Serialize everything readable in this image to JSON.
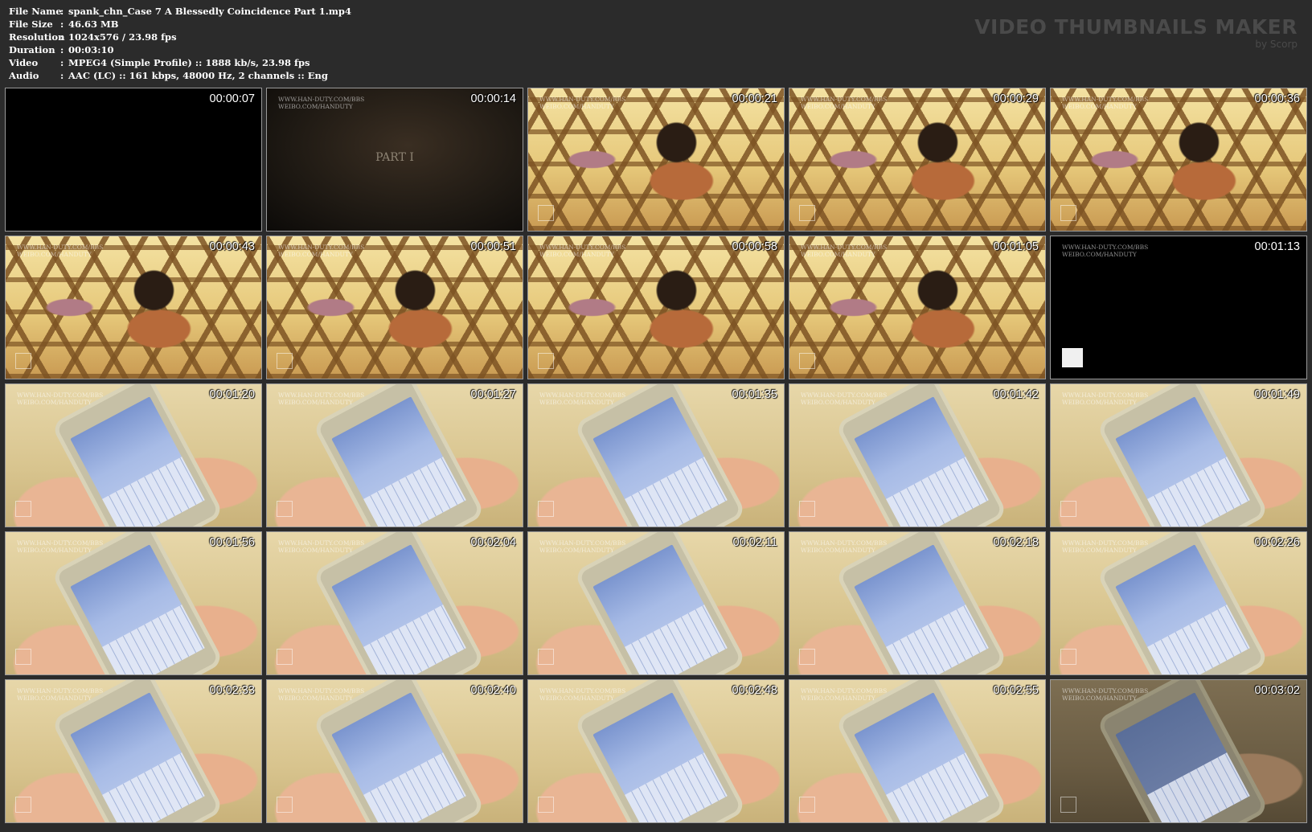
{
  "info": {
    "rows": [
      {
        "key": "File Name",
        "sep": ":",
        "value": "spank_chn_Case 7 A Blessedly Coincidence Part 1.mp4"
      },
      {
        "key": "File Size",
        "sep": ":",
        "value": "46.63 MB"
      },
      {
        "key": "Resolution",
        "sep": ":",
        "value": "1024x576 / 23.98 fps"
      },
      {
        "key": "Duration",
        "sep": ":",
        "value": "00:03:10"
      },
      {
        "key": "Video",
        "sep": ":",
        "value": "MPEG4 (Simple Profile) :: 1888 kb/s, 23.98 fps"
      },
      {
        "key": "Audio",
        "sep": ":",
        "value": "AAC (LC) :: 161 kbps, 48000 Hz, 2 channels :: Eng"
      }
    ]
  },
  "brand": {
    "title": "VIDEO THUMBNAILS MAKER",
    "subtitle": "by Scorp"
  },
  "watermark": "WWW.HAN-DUTY.COM/BBS\nWEIBO.COM/HANDUTY",
  "thumbnails": [
    {
      "time": "00:00:07",
      "scene": "black"
    },
    {
      "time": "00:00:14",
      "scene": "dark",
      "caption": "PART I"
    },
    {
      "time": "00:00:21",
      "scene": "mesh"
    },
    {
      "time": "00:00:29",
      "scene": "mesh"
    },
    {
      "time": "00:00:36",
      "scene": "mesh"
    },
    {
      "time": "00:00:43",
      "scene": "mesh"
    },
    {
      "time": "00:00:51",
      "scene": "mesh"
    },
    {
      "time": "00:00:58",
      "scene": "mesh"
    },
    {
      "time": "00:01:05",
      "scene": "mesh"
    },
    {
      "time": "00:01:13",
      "scene": "black-wm"
    },
    {
      "time": "00:01:20",
      "scene": "phone"
    },
    {
      "time": "00:01:27",
      "scene": "phone"
    },
    {
      "time": "00:01:35",
      "scene": "phone"
    },
    {
      "time": "00:01:42",
      "scene": "phone"
    },
    {
      "time": "00:01:49",
      "scene": "phone"
    },
    {
      "time": "00:01:56",
      "scene": "phone"
    },
    {
      "time": "00:02:04",
      "scene": "phone"
    },
    {
      "time": "00:02:11",
      "scene": "phone"
    },
    {
      "time": "00:02:18",
      "scene": "phone"
    },
    {
      "time": "00:02:26",
      "scene": "phone"
    },
    {
      "time": "00:02:33",
      "scene": "phone"
    },
    {
      "time": "00:02:40",
      "scene": "phone"
    },
    {
      "time": "00:02:48",
      "scene": "phone"
    },
    {
      "time": "00:02:55",
      "scene": "phone"
    },
    {
      "time": "00:03:02",
      "scene": "phone-dark"
    }
  ]
}
